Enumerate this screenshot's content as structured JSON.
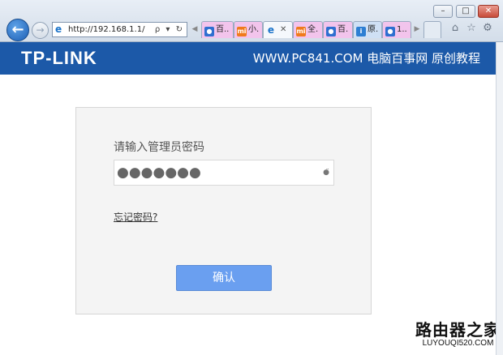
{
  "browser": {
    "address": "http://192.168.1.1/",
    "address_tools": "ρ ▾ ↻",
    "window_controls": {
      "minimize": "–",
      "maximize": "□",
      "close": "✕"
    },
    "tabs": [
      {
        "label": "百..",
        "favicon": "paw-icon",
        "color": "#2f6fd0",
        "style": "pink"
      },
      {
        "label": "小.",
        "favicon": "mi-icon",
        "color": "#f07a1c",
        "style": "pink"
      },
      {
        "label": "",
        "favicon": "ie-icon",
        "color": "#1a73c9",
        "style": "active",
        "close": "✕"
      },
      {
        "label": "全.",
        "favicon": "mi-icon",
        "color": "#f07a1c",
        "style": "pink"
      },
      {
        "label": "百.",
        "favicon": "paw-icon",
        "color": "#2f6fd0",
        "style": "pink"
      },
      {
        "label": "原.",
        "favicon": "info-icon",
        "color": "#2d7fd3",
        "style": "blue"
      },
      {
        "label": "1..",
        "favicon": "paw-icon",
        "color": "#2f6fd0",
        "style": "pink"
      }
    ],
    "right_tools": [
      "home-icon",
      "star-icon",
      "gear-icon"
    ]
  },
  "header": {
    "logo": "TP-LINK",
    "tagline": "WWW.PC841.COM 电脑百事网 原创教程"
  },
  "login": {
    "prompt": "请输入管理员密码",
    "password_masked": "●●●●●●●",
    "forgot_link": "忘记密码?",
    "confirm_button": "确认"
  },
  "watermark": {
    "title": "路由器之家",
    "url": "LUYOUQI520.COM"
  }
}
